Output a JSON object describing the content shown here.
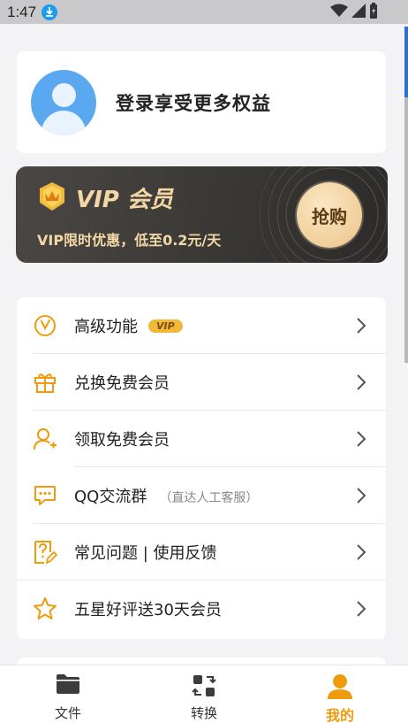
{
  "status_bar": {
    "time": "1:47"
  },
  "profile": {
    "title": "登录享受更多权益"
  },
  "vip_banner": {
    "title": "VIP 会员",
    "subtitle": "VIP限时优惠，低至0.2元/天",
    "button_label": "抢购"
  },
  "menu": {
    "items": [
      {
        "label": "高级功能",
        "tag": "VIP",
        "hint": ""
      },
      {
        "label": "兑换免费会员",
        "tag": "",
        "hint": ""
      },
      {
        "label": "领取免费会员",
        "tag": "",
        "hint": ""
      },
      {
        "label": "QQ交流群",
        "tag": "",
        "hint": "（直达人工客服）"
      },
      {
        "label": "常见问题 | 使用反馈",
        "tag": "",
        "hint": ""
      },
      {
        "label": "五星好评送30天会员",
        "tag": "",
        "hint": ""
      }
    ]
  },
  "tabs": [
    {
      "label": "文件"
    },
    {
      "label": "转换"
    },
    {
      "label": "我的"
    }
  ],
  "colors": {
    "accent": "#f09a0e",
    "vip_gold": "#f3d8a6",
    "vip_bg": "#3a3835"
  }
}
